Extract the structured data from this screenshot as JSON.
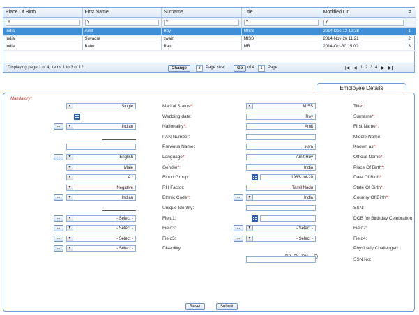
{
  "grid": {
    "columns": [
      "Place Of Birth",
      "First Name",
      "Surname",
      "Title",
      "Modified On",
      "#"
    ],
    "rows": [
      [
        "India",
        "Amit",
        "Roy",
        "MISS",
        "2014-Dec-12 12:38",
        "1"
      ],
      [
        "India",
        "Suvadra",
        "swain",
        "MISS",
        "2014-Nov-26 11:21",
        "2"
      ],
      [
        "India",
        "Babu",
        "Raju",
        "MR",
        "2014-Oct-30 15:00",
        "3"
      ]
    ],
    "selected_row": 0,
    "pager": {
      "display_text": "Displaying page 1 of 4, items 1 to 3 of 12.",
      "page_label": "Page",
      "page_value": "1",
      "of_label": "of 4",
      "go_label": "Go",
      "page_size_label": "Page size:",
      "page_size_value": "3",
      "change_label": "Change",
      "pages": [
        "1",
        "2",
        "3",
        "4"
      ]
    }
  },
  "form": {
    "tab_title": "Employee Details",
    "mandatory_note": "Mandatory",
    "left": [
      {
        "label": "Title",
        "req": true,
        "type": "select",
        "value": "MISS"
      },
      {
        "label": "Surname",
        "req": true,
        "type": "text",
        "value": "Roy"
      },
      {
        "label": "First Name",
        "req": true,
        "type": "text",
        "value": "Amit"
      },
      {
        "label": "Middle Name",
        "req": false,
        "type": "text",
        "value": ""
      },
      {
        "label": "Known as",
        "req": true,
        "type": "text",
        "value": "suva"
      },
      {
        "label": "Official Name",
        "req": true,
        "type": "text",
        "value": "Amit Roy"
      },
      {
        "label": "Place Of Birth",
        "req": true,
        "type": "text",
        "value": "India"
      },
      {
        "label": "Date Of Birth",
        "req": true,
        "type": "date",
        "value": "1983-Jul-20"
      },
      {
        "label": "State Of Birth",
        "req": true,
        "type": "text",
        "value": "Tamil Nadu"
      },
      {
        "label": "Country Of Birth",
        "req": true,
        "type": "lookup",
        "value": "India"
      },
      {
        "label": "SSN",
        "req": false,
        "type": "text",
        "value": ""
      },
      {
        "label": "DOB for Birthday Celebration",
        "req": false,
        "type": "date",
        "value": ""
      },
      {
        "label": "Field2",
        "req": false,
        "type": "lookup",
        "value": "- Select -"
      },
      {
        "label": "Field4",
        "req": false,
        "type": "lookup",
        "value": "- Select -"
      },
      {
        "label": "Physically Challenged",
        "req": false,
        "type": "radio",
        "value": ""
      },
      {
        "label": "SSN No",
        "req": false,
        "type": "text",
        "value": ""
      }
    ],
    "radio": {
      "yes": "Yes",
      "no": "No",
      "selected": "No"
    },
    "right": [
      {
        "label": "Marital Status",
        "req": true,
        "type": "select",
        "value": "Single"
      },
      {
        "label": "Wedding date",
        "req": false,
        "type": "datebox",
        "value": ""
      },
      {
        "label": "Nationality",
        "req": true,
        "type": "lookup",
        "value": "Indian"
      },
      {
        "label": "PAN Number",
        "req": false,
        "type": "short",
        "value": ""
      },
      {
        "label": "Previous Name",
        "req": false,
        "type": "text",
        "value": ""
      },
      {
        "label": "Language",
        "req": true,
        "type": "lookup",
        "value": "English"
      },
      {
        "label": "Gender",
        "req": true,
        "type": "select",
        "value": "Male"
      },
      {
        "label": "Blood Group",
        "req": false,
        "type": "select",
        "value": "A1"
      },
      {
        "label": "RH Factor",
        "req": false,
        "type": "select",
        "value": "Negative"
      },
      {
        "label": "Ethnic Code",
        "req": true,
        "type": "lookup",
        "value": "Indian"
      },
      {
        "label": "Unique Identity",
        "req": false,
        "type": "short",
        "value": ""
      },
      {
        "label": "Field1",
        "req": false,
        "type": "lookup",
        "value": "- Select -"
      },
      {
        "label": "Field3",
        "req": false,
        "type": "lookup",
        "value": "- Select -"
      },
      {
        "label": "Field5",
        "req": false,
        "type": "lookup",
        "value": "- Select -"
      },
      {
        "label": "Disability",
        "req": false,
        "type": "lookup",
        "value": "- Select -"
      }
    ],
    "buttons": {
      "submit": "Submit",
      "reset": "Reset"
    }
  }
}
